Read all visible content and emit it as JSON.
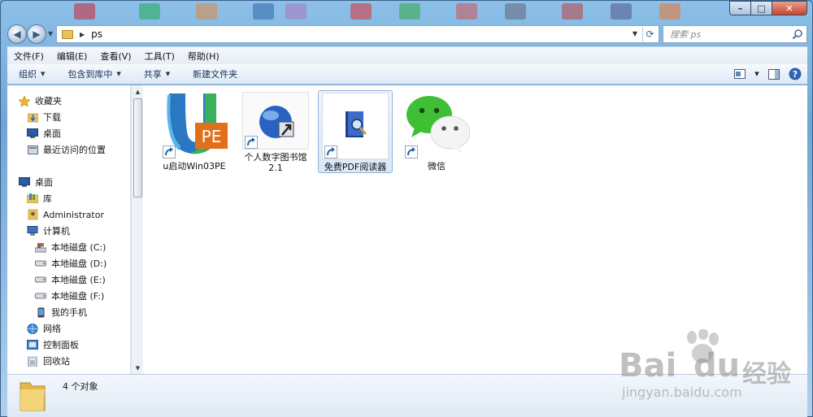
{
  "window": {
    "min": "–",
    "max": "□",
    "close": "✕"
  },
  "address": {
    "path": "ps"
  },
  "search": {
    "placeholder": "搜索 ps"
  },
  "menu": [
    "文件(F)",
    "编辑(E)",
    "查看(V)",
    "工具(T)",
    "帮助(H)"
  ],
  "toolbar": {
    "organize": "组织",
    "include_library": "包含到库中",
    "share": "共享",
    "new_folder": "新建文件夹"
  },
  "nav": {
    "favorites": "收藏夹",
    "downloads": "下载",
    "desktop_fav": "桌面",
    "recent": "最近访问的位置",
    "desktop": "桌面",
    "library": "库",
    "administrator": "Administrator",
    "computer": "计算机",
    "disk_c": "本地磁盘 (C:)",
    "disk_d": "本地磁盘 (D:)",
    "disk_e": "本地磁盘 (E:)",
    "disk_f": "本地磁盘 (F:)",
    "phone": "我的手机",
    "network": "网络",
    "control_panel": "控制面板",
    "recycle_bin": "回收站"
  },
  "files": [
    {
      "name": "u启动Win03PE",
      "icon": "upe-logo-icon"
    },
    {
      "name": "个人数字图书馆2.1",
      "icon": "digital-library-icon"
    },
    {
      "name": "免费PDF阅读器",
      "icon": "pdf-reader-icon",
      "selected": true
    },
    {
      "name": "微信",
      "icon": "wechat-icon"
    }
  ],
  "status": {
    "count": "4 个对象"
  },
  "watermark": {
    "brand": "Bai",
    "brand2": "du",
    "cn": "经验",
    "url": "jingyan.baidu.com"
  }
}
